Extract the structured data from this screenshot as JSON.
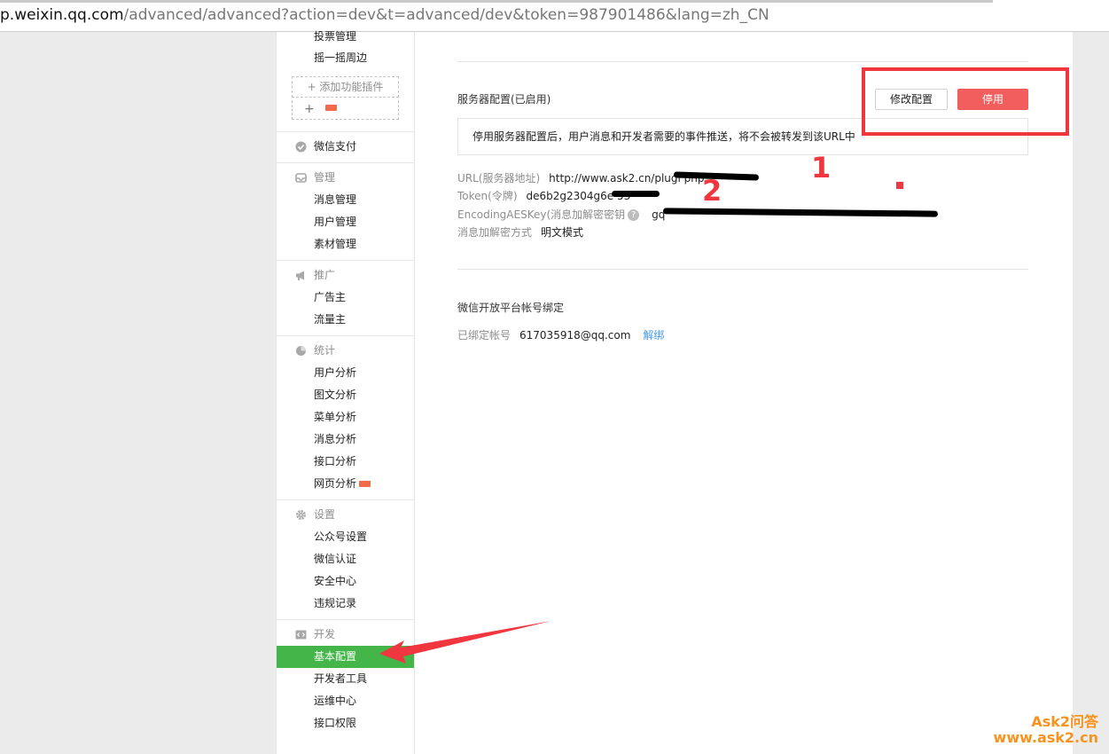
{
  "browser": {
    "url_host": "p.weixin.qq.com",
    "url_path": "/advanced/advanced?action=dev&t=advanced/dev&token=987901486&lang=zh_CN"
  },
  "sidebar": {
    "items_top": [
      "投票管理",
      "摇一摇周边"
    ],
    "plugin_add_label": "+ 添加功能插件",
    "plugin_plus": "+",
    "pay": "微信支付",
    "manage": {
      "head": "管理",
      "items": [
        "消息管理",
        "用户管理",
        "素材管理"
      ]
    },
    "promote": {
      "head": "推广",
      "items": [
        "广告主",
        "流量主"
      ]
    },
    "stats": {
      "head": "统计",
      "items": [
        "用户分析",
        "图文分析",
        "菜单分析",
        "消息分析",
        "接口分析",
        "网页分析"
      ]
    },
    "settings": {
      "head": "设置",
      "items": [
        "公众号设置",
        "微信认证",
        "安全中心",
        "违规记录"
      ]
    },
    "dev": {
      "head": "开发",
      "items": [
        "基本配置",
        "开发者工具",
        "运维中心",
        "接口权限"
      ],
      "active_index": 0
    }
  },
  "server_config": {
    "title": "服务器配置(已启用)",
    "modify_button": "修改配置",
    "stop_button": "停用",
    "tip": "停用服务器配置后，用户消息和开发者需要的事件推送，将不会被转发到该URL中",
    "fields": [
      {
        "label": "URL(服务器地址)",
        "value": "http://www.ask2.cn/plugi            php"
      },
      {
        "label": "Token(令牌)",
        "value": "de6b2g2304g6e          53"
      },
      {
        "label": "EncodingAESKey(消息加解密密钥",
        "help": "?",
        "value": "gq"
      },
      {
        "label": "消息加解密方式",
        "value": "明文模式"
      }
    ]
  },
  "open_platform": {
    "title": "微信开放平台帐号绑定",
    "bound_label": "已绑定帐号",
    "bound_value": "617035918@qq.com",
    "unbind_link": "解绑"
  },
  "annotations": {
    "mark1": "1",
    "mark2": "2"
  },
  "watermark": {
    "line1": "Ask2问答",
    "line2": "www.ask2.cn"
  },
  "colors": {
    "active_green": "#44b549",
    "warn_red": "#f25d5d",
    "link_blue": "#459ae9",
    "annotation_red": "#f0363f"
  }
}
